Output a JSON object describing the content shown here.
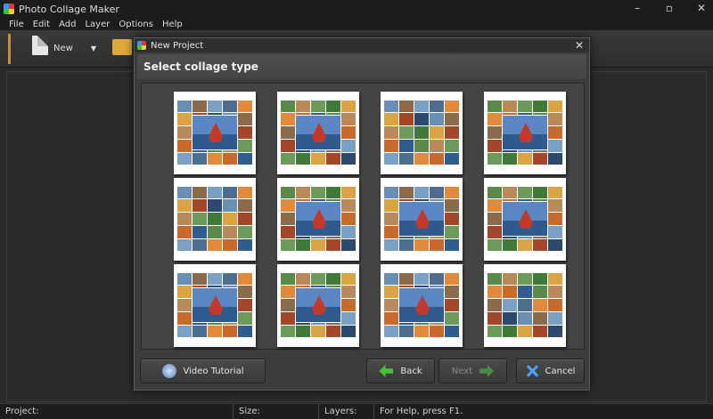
{
  "app": {
    "title": "Photo Collage Maker"
  },
  "window_controls": {
    "minimize": "–",
    "maximize": "▫",
    "close": "✕"
  },
  "menu": [
    "File",
    "Edit",
    "Add",
    "Layer",
    "Options",
    "Help"
  ],
  "toolbar": {
    "new_label": "New",
    "new_caret": "▼"
  },
  "dialog": {
    "title": "New Project",
    "close": "✕",
    "header": "Select collage type",
    "buttons": {
      "video_tutorial": "Video Tutorial",
      "back": "Back",
      "next": "Next",
      "cancel": "Cancel"
    }
  },
  "statusbar": {
    "project": "Project:",
    "size": "Size:",
    "layers": "Layers:",
    "help": "For Help, press F1."
  },
  "colors": {
    "accent": "#c8922a",
    "back_arrow": "#46c23d",
    "cancel_icon": "#4aa3ff"
  },
  "collage_templates": 12
}
